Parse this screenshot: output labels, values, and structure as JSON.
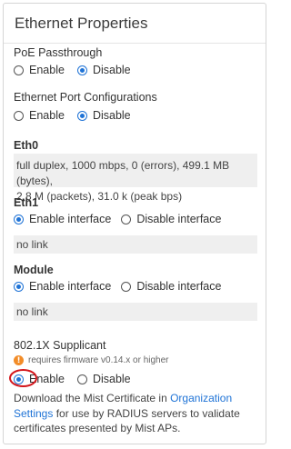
{
  "header": {
    "title": "Ethernet Properties"
  },
  "poe": {
    "label": "PoE Passthrough",
    "options": [
      {
        "label": "Enable",
        "checked": false
      },
      {
        "label": "Disable",
        "checked": true
      }
    ]
  },
  "port_config": {
    "label": "Ethernet Port Configurations",
    "options": [
      {
        "label": "Enable",
        "checked": false
      },
      {
        "label": "Disable",
        "checked": true
      }
    ]
  },
  "eth0": {
    "label": "Eth0",
    "stats_line1": "full duplex, 1000 mbps, 0 (errors), 499.1 MB (bytes),",
    "stats_line2": "2.8 M (packets), 31.0 k (peak bps)"
  },
  "eth1": {
    "label": "Eth1",
    "options": [
      {
        "label": "Enable interface",
        "checked": true
      },
      {
        "label": "Disable interface",
        "checked": false
      }
    ],
    "status": "no link"
  },
  "module": {
    "label": "Module",
    "options": [
      {
        "label": "Enable interface",
        "checked": true
      },
      {
        "label": "Disable interface",
        "checked": false
      }
    ],
    "status": "no link"
  },
  "supplicant": {
    "label": "802.1X Supplicant",
    "warning_icon": "exclamation-icon",
    "warning": "requires firmware v0.14.x or higher",
    "options": [
      {
        "label": "Enable",
        "checked": true
      },
      {
        "label": "Disable",
        "checked": false
      }
    ],
    "desc_part1": "Download the Mist Certificate in ",
    "link_text_1": "Organization",
    "link_text_2": "Settings",
    "desc_part2": " for use by RADIUS servers to validate",
    "desc_part3": "certificates presented by Mist APs."
  },
  "colors": {
    "accent": "#1f73d6",
    "warning": "#f28c28",
    "annotation": "#d3161c"
  }
}
